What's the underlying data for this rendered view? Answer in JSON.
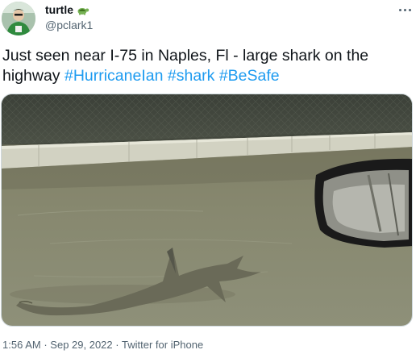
{
  "author": {
    "display_name": "turtle",
    "handle": "@pclark1",
    "avatar_icon": "profile-avatar",
    "badge_icon": "turtle-emoji-icon"
  },
  "tweet": {
    "text_plain": "Just seen near I-75 in Naples, Fl - large shark on the highway",
    "hashtags": [
      "#HurricaneIan",
      "#shark",
      "#BeSafe"
    ],
    "media_alt": "Shark swimming in floodwater on a highway next to a car side mirror"
  },
  "meta": {
    "time": "1:56 AM",
    "date": "Sep 29, 2022",
    "source": "Twitter for iPhone",
    "separator": "·"
  },
  "colors": {
    "link": "#1d9bf0",
    "secondary_text": "#536471",
    "border": "#cfd9de"
  }
}
